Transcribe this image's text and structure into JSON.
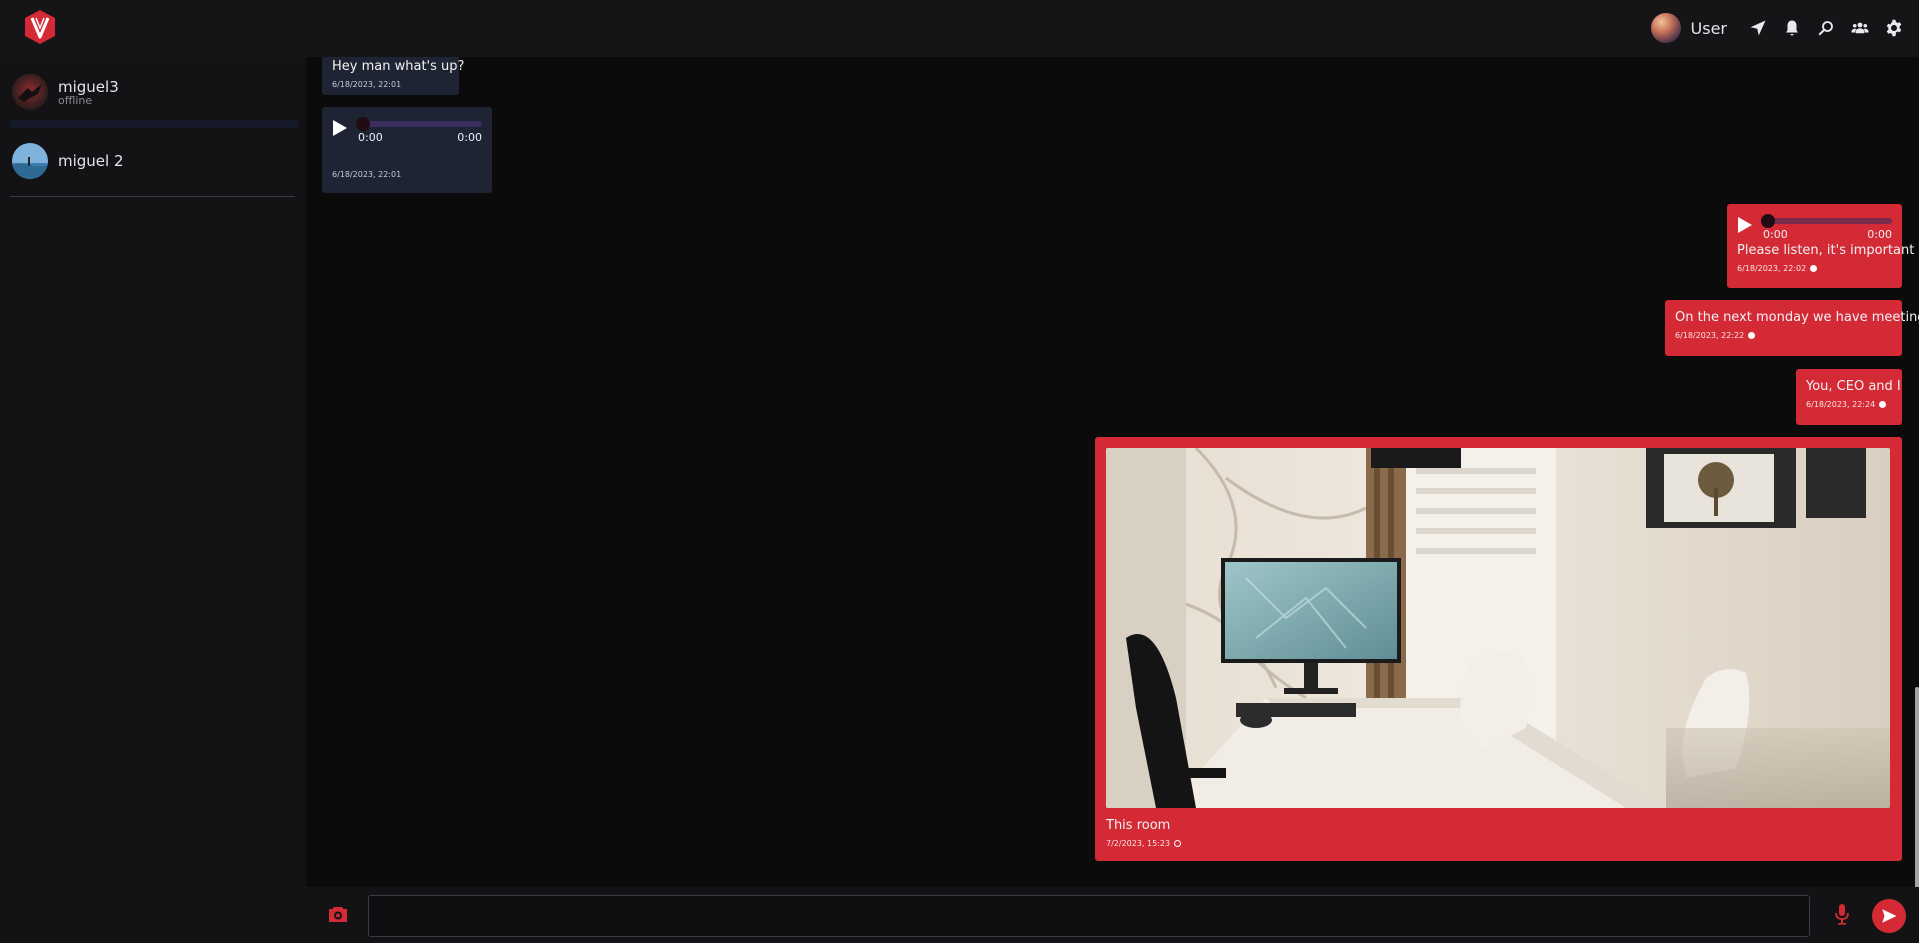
{
  "header": {
    "user_name": "User",
    "icons": [
      "send-location-icon",
      "bell-icon",
      "search-icon",
      "group-icon",
      "gear-icon"
    ]
  },
  "sidebar": {
    "contacts": [
      {
        "name": "miguel3",
        "status": "offline"
      },
      {
        "name": "miguel 2",
        "status": ""
      }
    ]
  },
  "chat": {
    "messages": [
      {
        "direction": "in",
        "type": "text",
        "text": "Hey man what's up?",
        "time": "6/18/2023, 22:01"
      },
      {
        "direction": "in",
        "type": "audio",
        "current": "0:00",
        "duration": "0:00",
        "time": "6/18/2023, 22:01"
      },
      {
        "direction": "out",
        "type": "audio",
        "current": "0:00",
        "duration": "0:00",
        "text": "Please listen, it's important",
        "time": "6/18/2023, 22:02"
      },
      {
        "direction": "out",
        "type": "text",
        "text": "On the next monday we have meeting",
        "time": "6/18/2023, 22:22"
      },
      {
        "direction": "out",
        "type": "text",
        "text": "You, CEO and I",
        "time": "6/18/2023, 22:24"
      },
      {
        "direction": "out",
        "type": "image",
        "text": "This room",
        "time": "7/2/2023, 15:23"
      }
    ]
  },
  "composer": {
    "placeholder": ""
  },
  "colors": {
    "accent": "#d32a35",
    "incoming_bubble": "#1e2433",
    "background": "#0b0b0c",
    "panel": "#151518"
  }
}
